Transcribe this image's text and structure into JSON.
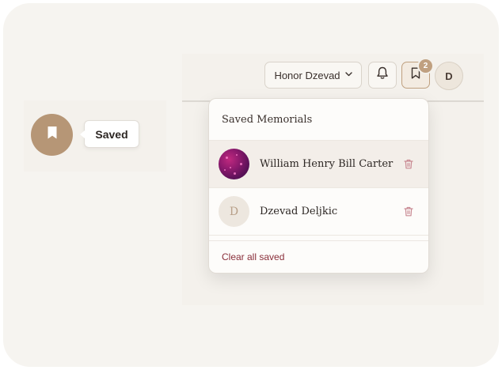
{
  "header": {
    "user_button_label": "Honor Dzevad",
    "bookmark_badge_count": "2",
    "avatar_initial": "D"
  },
  "tooltip": {
    "label": "Saved"
  },
  "dropdown": {
    "title": "Saved Memorials",
    "items": [
      {
        "name": "William Henry Bill Carter",
        "avatar_type": "photo"
      },
      {
        "name": "Dzevad Deljkic",
        "avatar_initial": "D"
      }
    ],
    "clear_all_label": "Clear all saved"
  },
  "colors": {
    "accent": "#b69676",
    "danger_text": "#8a2f3a",
    "background": "#f6f4f0"
  }
}
